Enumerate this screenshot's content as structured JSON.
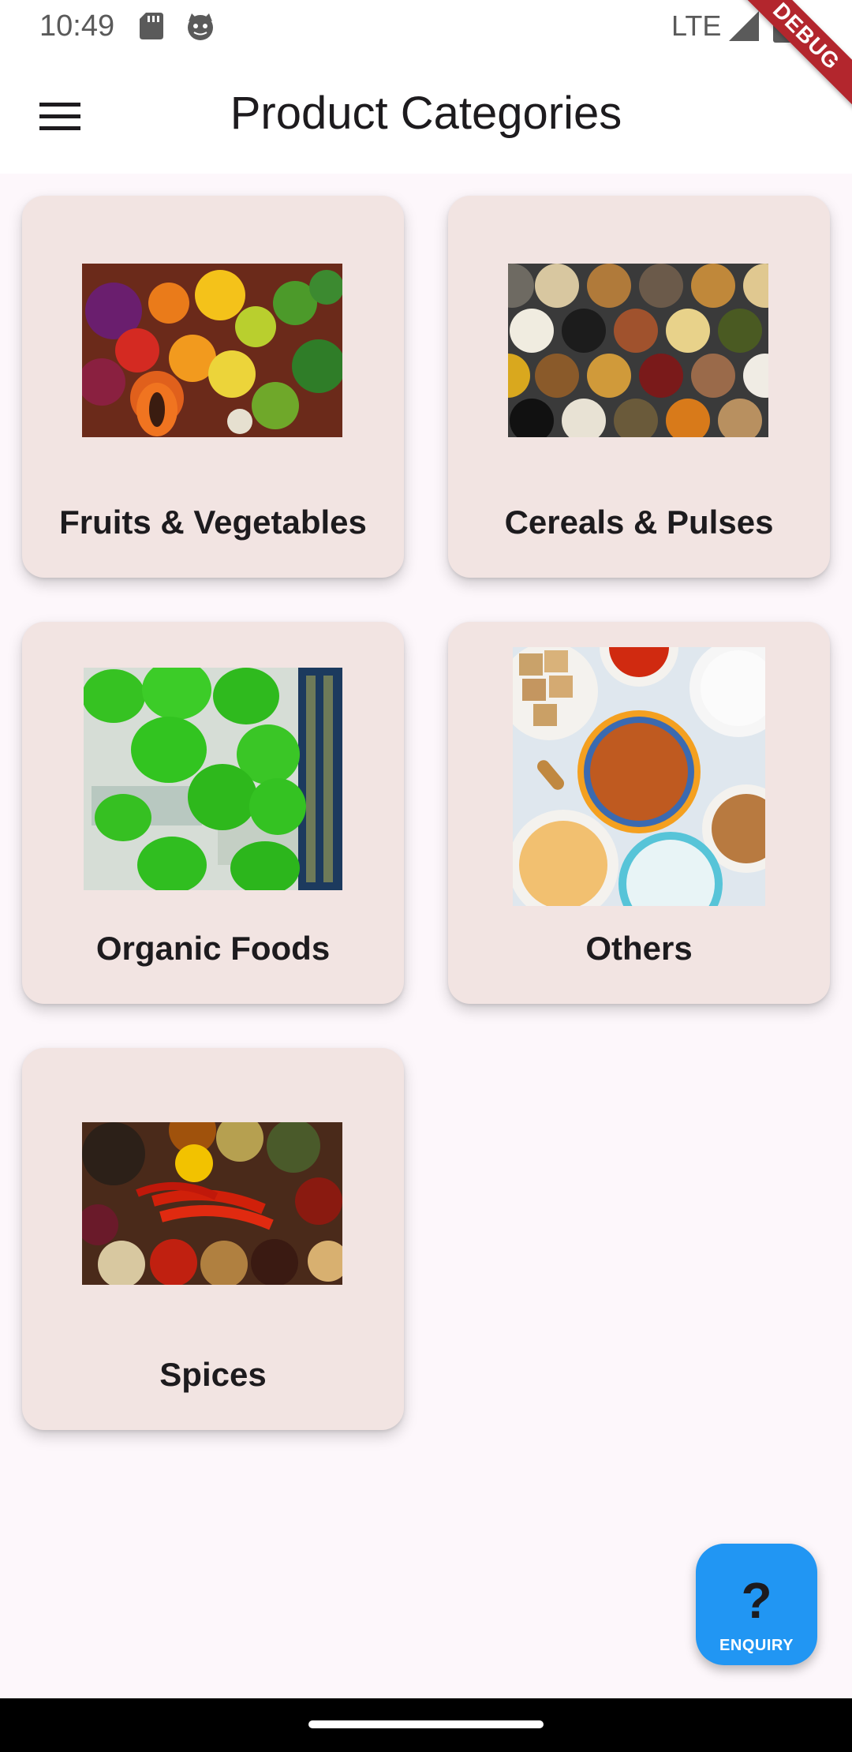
{
  "status_bar": {
    "time": "10:49",
    "network": "LTE",
    "icons": [
      "sd-card-icon",
      "cat-icon",
      "signal-icon",
      "battery-icon"
    ]
  },
  "debug_banner": "DEBUG",
  "app_bar": {
    "title": "Product Categories",
    "menu_icon": "hamburger-menu-icon"
  },
  "categories": [
    {
      "label": "Fruits & Vegetables",
      "image": "fruits-vegetables-image"
    },
    {
      "label": "Cereals & Pulses",
      "image": "cereals-pulses-image"
    },
    {
      "label": "Organic Foods",
      "image": "organic-foods-image"
    },
    {
      "label": "Others",
      "image": "others-image"
    },
    {
      "label": "Spices",
      "image": "spices-image"
    }
  ],
  "fab": {
    "icon": "?",
    "label": "ENQUIRY"
  },
  "colors": {
    "background": "#fdf7fb",
    "card": "#f2e4e2",
    "fab": "#2196f3",
    "debug_ribbon": "#b3262d"
  }
}
